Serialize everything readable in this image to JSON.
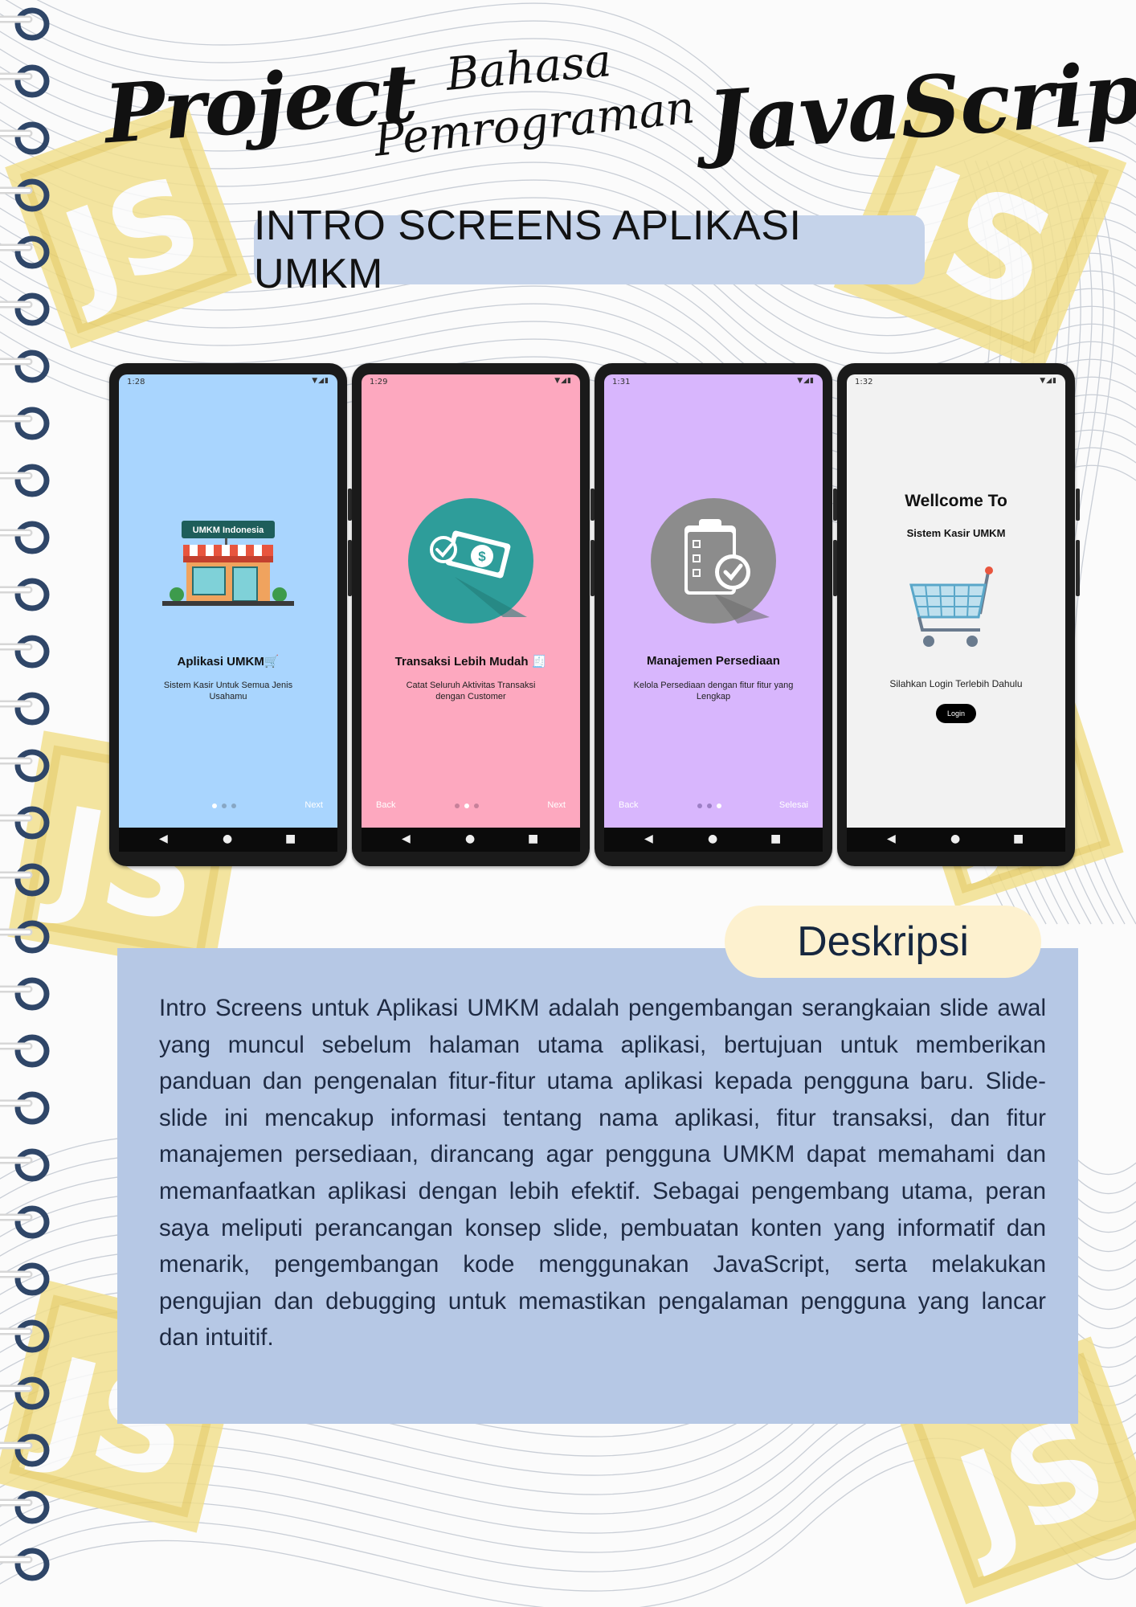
{
  "header": {
    "title_word_1": "Project",
    "title_word_2": "Bahasa",
    "title_word_3": "Pemrograman",
    "title_word_4": "JavaScript",
    "subtitle": "INTRO SCREENS APLIKASI UMKM"
  },
  "phones": [
    {
      "time": "1:28",
      "bg_color": "#a9d5fe",
      "shop_sign": "UMKM Indonesia",
      "title": "Aplikasi UMKM🛒",
      "description": "Sistem Kasir Untuk Semua Jenis Usahamu",
      "nav_left": "",
      "nav_right": "Next",
      "active_dot": 1
    },
    {
      "time": "1:29",
      "bg_color": "#fda8bf",
      "title": "Transaksi Lebih Mudah 🧾",
      "description": "Catat Seluruh Aktivitas Transaksi dengan Customer",
      "nav_left": "Back",
      "nav_right": "Next",
      "active_dot": 2
    },
    {
      "time": "1:31",
      "bg_color": "#d8b6fd",
      "title": "Manajemen Persediaan",
      "description": "Kelola Persediaan dengan fitur fitur yang Lengkap",
      "nav_left": "Back",
      "nav_right": "Selesai",
      "active_dot": 3
    },
    {
      "time": "1:32",
      "bg_color": "#f2f2f2",
      "welcome": "Wellcome To",
      "app_name": "Sistem Kasir UMKM",
      "prompt": "Silahkan Login Terlebih Dahulu",
      "login_label": "Login"
    }
  ],
  "description": {
    "heading": "Deskripsi",
    "body": "Intro Screens untuk Aplikasi UMKM adalah pengembangan serangkaian slide awal yang muncul sebelum halaman utama aplikasi, bertujuan untuk memberikan panduan dan pengenalan fitur-fitur utama aplikasi kepada pengguna baru. Slide-slide ini mencakup informasi tentang nama aplikasi, fitur transaksi, dan fitur manajemen persediaan, dirancang agar pengguna UMKM dapat memahami dan memanfaatkan aplikasi dengan lebih efektif. Sebagai pengembang utama, peran saya meliputi perancangan konsep slide, pembuatan konten yang informatif dan menarik, pengembangan kode menggunakan JavaScript, serta melakukan pengujian dan debugging untuk memastikan pengalaman pengguna yang lancar dan intuitif."
  },
  "decoration": {
    "js_logo_letters": "JS",
    "colors": {
      "js_yellow": "#f2e08f",
      "js_yellow_dark": "#e8cf6a",
      "ring_navy": "#2f4668",
      "line_color": "#c9ced6",
      "subtitle_pill": "#c5d3ea",
      "desc_card": "#b6c8e5",
      "desc_pill": "#fdf1cf",
      "teal_circle": "#2e9d9a",
      "grey_circle": "#8c8c8c"
    },
    "icons": [
      "shop-icon",
      "money-check-icon",
      "clipboard-check-icon",
      "shopping-cart-icon"
    ]
  }
}
